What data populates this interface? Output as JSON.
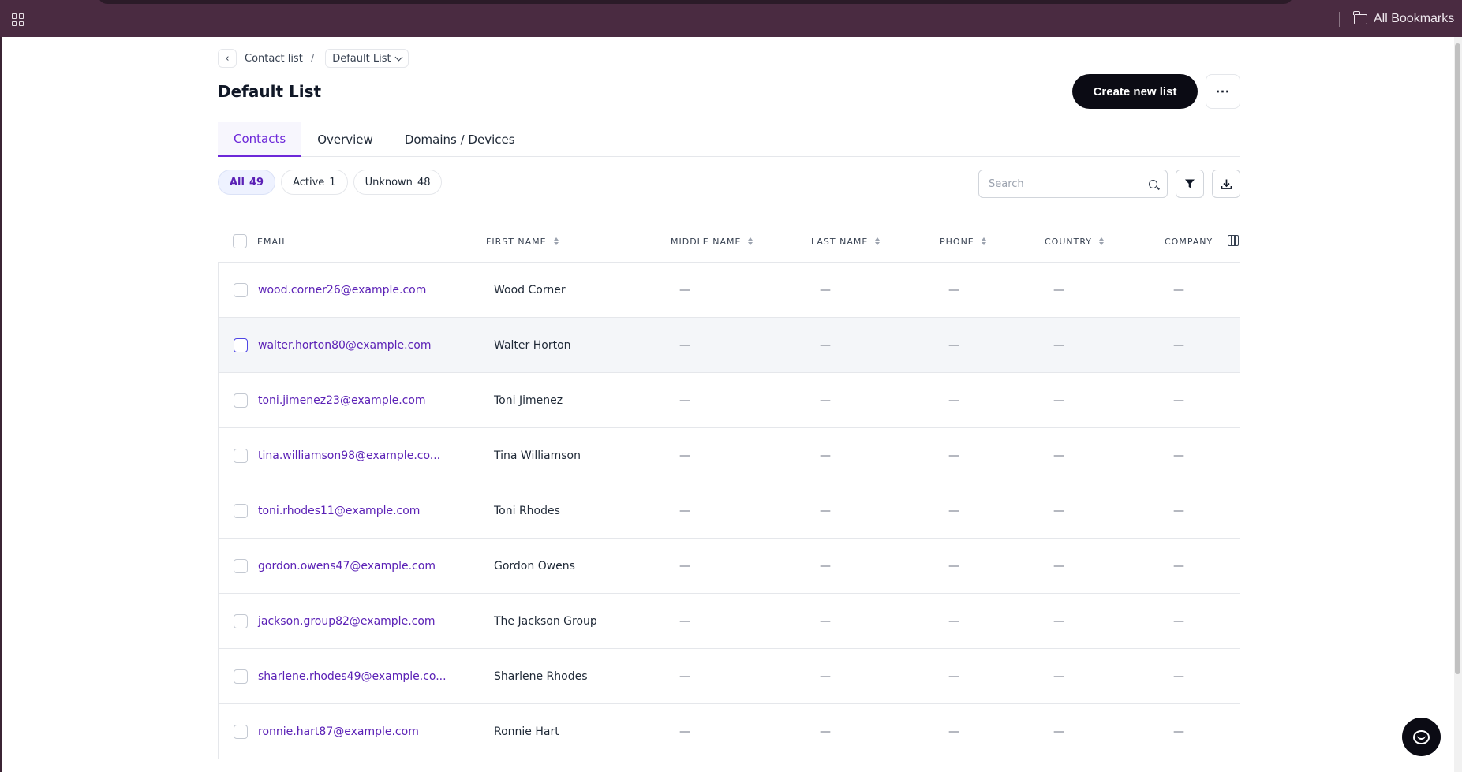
{
  "browser": {
    "bookmarks_label": "All Bookmarks"
  },
  "breadcrumb": {
    "parent": "Contact list",
    "separator": "/",
    "current": "Default List"
  },
  "page": {
    "title": "Default List",
    "create_button": "Create new list",
    "more_button": "⋯"
  },
  "tabs": [
    {
      "label": "Contacts",
      "active": true
    },
    {
      "label": "Overview",
      "active": false
    },
    {
      "label": "Domains / Devices",
      "active": false
    }
  ],
  "filters": [
    {
      "label": "All",
      "count": "49",
      "active": true
    },
    {
      "label": "Active",
      "count": "1",
      "active": false
    },
    {
      "label": "Unknown",
      "count": "48",
      "active": false
    }
  ],
  "search": {
    "placeholder": "Search"
  },
  "columns": {
    "email": "EMAIL",
    "first_name": "FIRST NAME",
    "middle_name": "MIDDLE NAME",
    "last_name": "LAST NAME",
    "phone": "PHONE",
    "country": "COUNTRY",
    "company": "COMPANY"
  },
  "rows": [
    {
      "email": "wood.corner26@example.com",
      "first_name": "Wood Corner",
      "middle_name": "—",
      "last_name": "—",
      "phone": "—",
      "country": "—",
      "company": "—"
    },
    {
      "email": "walter.horton80@example.com",
      "first_name": "Walter Horton",
      "middle_name": "—",
      "last_name": "—",
      "phone": "—",
      "country": "—",
      "company": "—"
    },
    {
      "email": "toni.jimenez23@example.com",
      "first_name": "Toni Jimenez",
      "middle_name": "—",
      "last_name": "—",
      "phone": "—",
      "country": "—",
      "company": "—"
    },
    {
      "email": "tina.williamson98@example.co...",
      "first_name": "Tina Williamson",
      "middle_name": "—",
      "last_name": "—",
      "phone": "—",
      "country": "—",
      "company": "—"
    },
    {
      "email": "toni.rhodes11@example.com",
      "first_name": "Toni Rhodes",
      "middle_name": "—",
      "last_name": "—",
      "phone": "—",
      "country": "—",
      "company": "—"
    },
    {
      "email": "gordon.owens47@example.com",
      "first_name": "Gordon Owens",
      "middle_name": "—",
      "last_name": "—",
      "phone": "—",
      "country": "—",
      "company": "—"
    },
    {
      "email": "jackson.group82@example.com",
      "first_name": "The Jackson Group",
      "middle_name": "—",
      "last_name": "—",
      "phone": "—",
      "country": "—",
      "company": "—"
    },
    {
      "email": "sharlene.rhodes49@example.co...",
      "first_name": "Sharlene Rhodes",
      "middle_name": "—",
      "last_name": "—",
      "phone": "—",
      "country": "—",
      "company": "—"
    },
    {
      "email": "ronnie.hart87@example.com",
      "first_name": "Ronnie Hart",
      "middle_name": "—",
      "last_name": "—",
      "phone": "—",
      "country": "—",
      "company": "—"
    }
  ],
  "colors": {
    "browser_bar": "#4a2b41",
    "accent": "#6d28d9",
    "primary_button": "#0b0b14"
  }
}
